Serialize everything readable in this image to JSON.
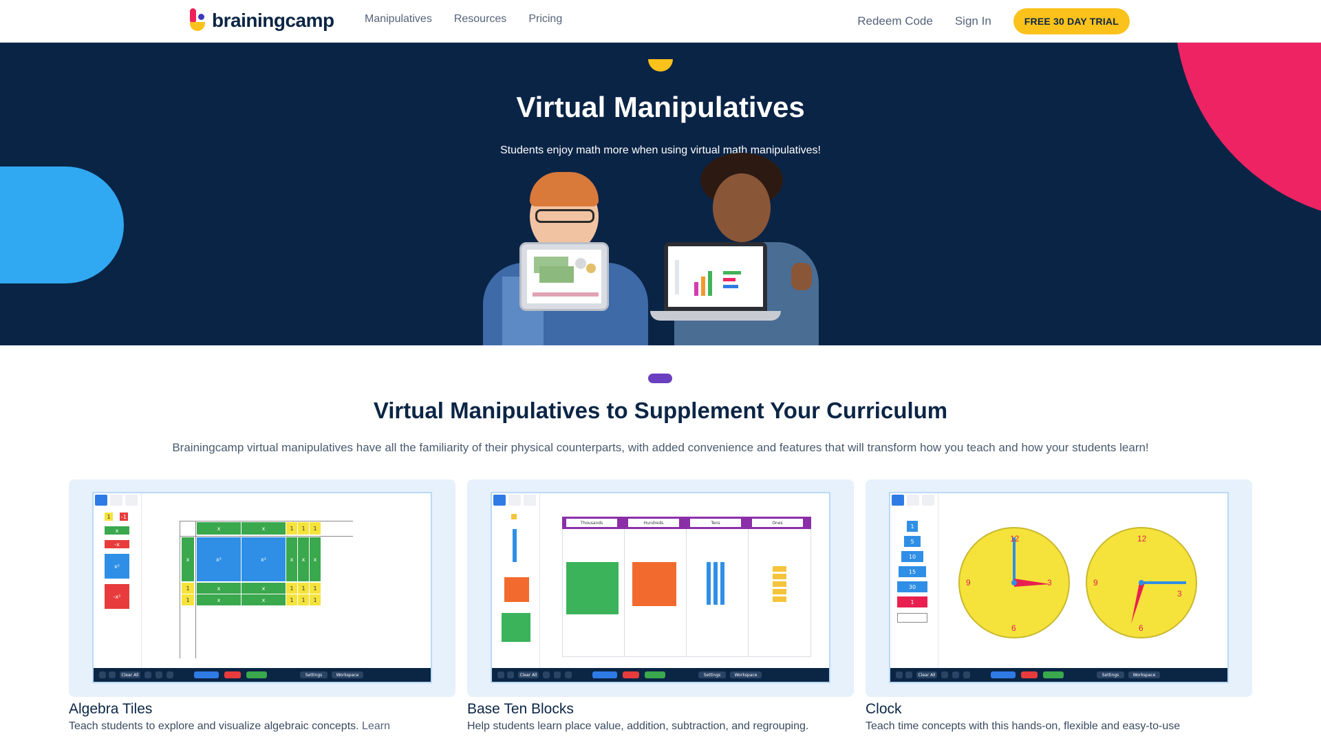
{
  "nav": {
    "brand": "brainingcamp",
    "links": [
      "Manipulatives",
      "Resources",
      "Pricing"
    ],
    "redeem": "Redeem Code",
    "signin": "Sign In",
    "trial": "FREE 30 DAY TRIAL"
  },
  "hero": {
    "title": "Virtual Manipulatives",
    "subtitle": "Students enjoy math more when using virtual math manipulatives!"
  },
  "section": {
    "title": "Virtual Manipulatives to Supplement Your Curriculum",
    "subtitle": "Brainingcamp virtual manipulatives have all the familiarity of their physical counterparts, with added convenience and features that will transform how you teach and how your students learn!"
  },
  "cards": [
    {
      "title": "Algebra Tiles",
      "desc": "Teach students to explore and visualize algebraic concepts.",
      "more": "Learn"
    },
    {
      "title": "Base Ten Blocks",
      "desc": "Help students learn place value, addition, subtraction, and regrouping.",
      "more": ""
    },
    {
      "title": "Clock",
      "desc": "Teach time concepts with this hands-on, flexible and easy-to-use",
      "more": ""
    }
  ],
  "app": {
    "clear_all": "Clear All",
    "settings": "Settings",
    "workspace": "Workspace",
    "place_values": [
      "Thousands",
      "Hundreds",
      "Tens",
      "Ones"
    ],
    "clock_steps": [
      "1",
      "5",
      "10",
      "15",
      "30",
      "1"
    ]
  },
  "colors": {
    "navy": "#0a2446",
    "yellow": "#fbc21b",
    "pink": "#ee2363",
    "blue": "#31a8f2",
    "purple": "#6a3fc0"
  }
}
